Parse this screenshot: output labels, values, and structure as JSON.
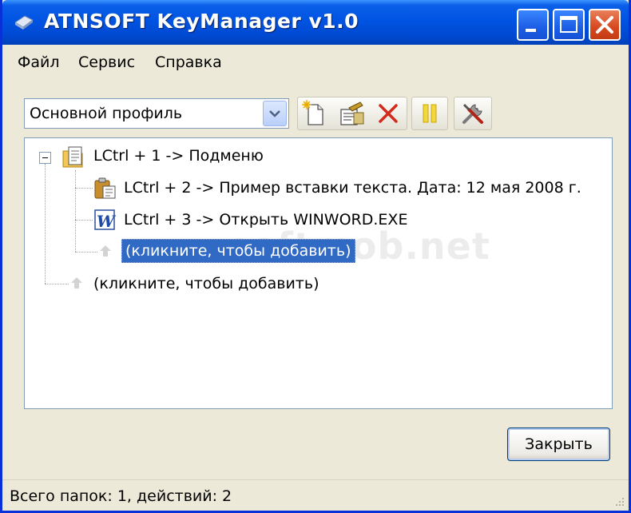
{
  "window": {
    "title": "ATNSOFT KeyManager v1.0"
  },
  "menu": {
    "file": "Файл",
    "service": "Сервис",
    "help": "Справка"
  },
  "toolbar": {
    "profile_value": "Основной профиль",
    "icons": [
      "new-icon",
      "edit-properties-icon",
      "delete-icon",
      "pause-icon",
      "settings-tools-icon"
    ]
  },
  "tree": {
    "root": {
      "label": "LCtrl + 1 -> Подменю",
      "icon": "folder-document-icon",
      "children": [
        {
          "label": "LCtrl + 2 -> Пример вставки текста. Дата: 12 мая 2008 г.",
          "icon": "clipboard-paste-icon"
        },
        {
          "label": "LCtrl + 3 -> Открыть WINWORD.EXE",
          "icon": "word-icon"
        },
        {
          "label": "(кликните, чтобы добавить)",
          "icon": "add-arrow-icon",
          "selected": true
        }
      ]
    },
    "root_add": {
      "label": "(кликните, чтобы добавить)",
      "icon": "add-arrow-icon"
    },
    "watermark": "softmob.net"
  },
  "buttons": {
    "close": "Закрыть"
  },
  "status": {
    "text": "Всего папок: 1, действий: 2"
  },
  "colors": {
    "titlebar": "#0054e3",
    "selection": "#316ac5",
    "face": "#ece9d8"
  }
}
